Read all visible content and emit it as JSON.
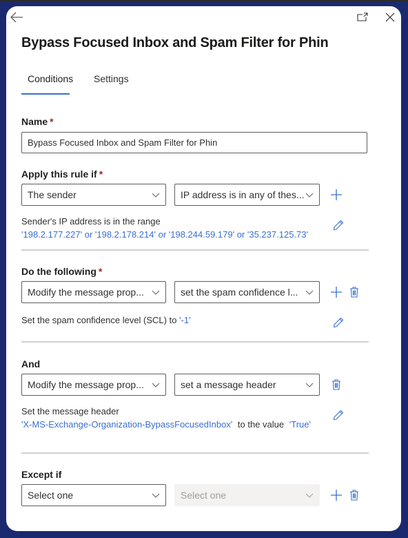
{
  "window": {
    "back_icon": "arrow-left-icon",
    "popout_icon": "open-in-new-window-icon",
    "close_icon": "close-icon"
  },
  "header": {
    "title": "Bypass Focused Inbox and Spam Filter for Phin"
  },
  "tabs": [
    {
      "label": "Conditions",
      "active": true
    },
    {
      "label": "Settings",
      "active": false
    }
  ],
  "name_field": {
    "label": "Name",
    "required_marker": "*",
    "value": "Bypass Focused Inbox and Spam Filter for Phin"
  },
  "apply_rule": {
    "label": "Apply this rule if",
    "required_marker": "*",
    "select1": "The sender",
    "select2": "IP address is in any of thes...",
    "description_prefix": "Sender's IP address is in the range",
    "description_values": "'198.2.177.227' or '198.2.178.214' or '198.244.59.179' or '35.237.125.73'"
  },
  "do_following": {
    "label": "Do the following",
    "required_marker": "*",
    "select1": "Modify the message prop...",
    "select2": "set the spam confidence l...",
    "description_prefix": "Set the spam confidence level (SCL) to",
    "description_value": "'-1'"
  },
  "and_action": {
    "label": "And",
    "select1": "Modify the message prop...",
    "select2": "set a message header",
    "description_prefix": "Set the message header",
    "header_name": "'X-MS-Exchange-Organization-BypassFocusedInbox'",
    "middle_text": "to the value",
    "header_value": "'True'"
  },
  "except_if": {
    "label": "Except if",
    "select1": "Select one",
    "select2": "Select one"
  },
  "colors": {
    "accent": "#3a6fd0",
    "frame": "#1b2a6e",
    "required": "#a4262c"
  }
}
